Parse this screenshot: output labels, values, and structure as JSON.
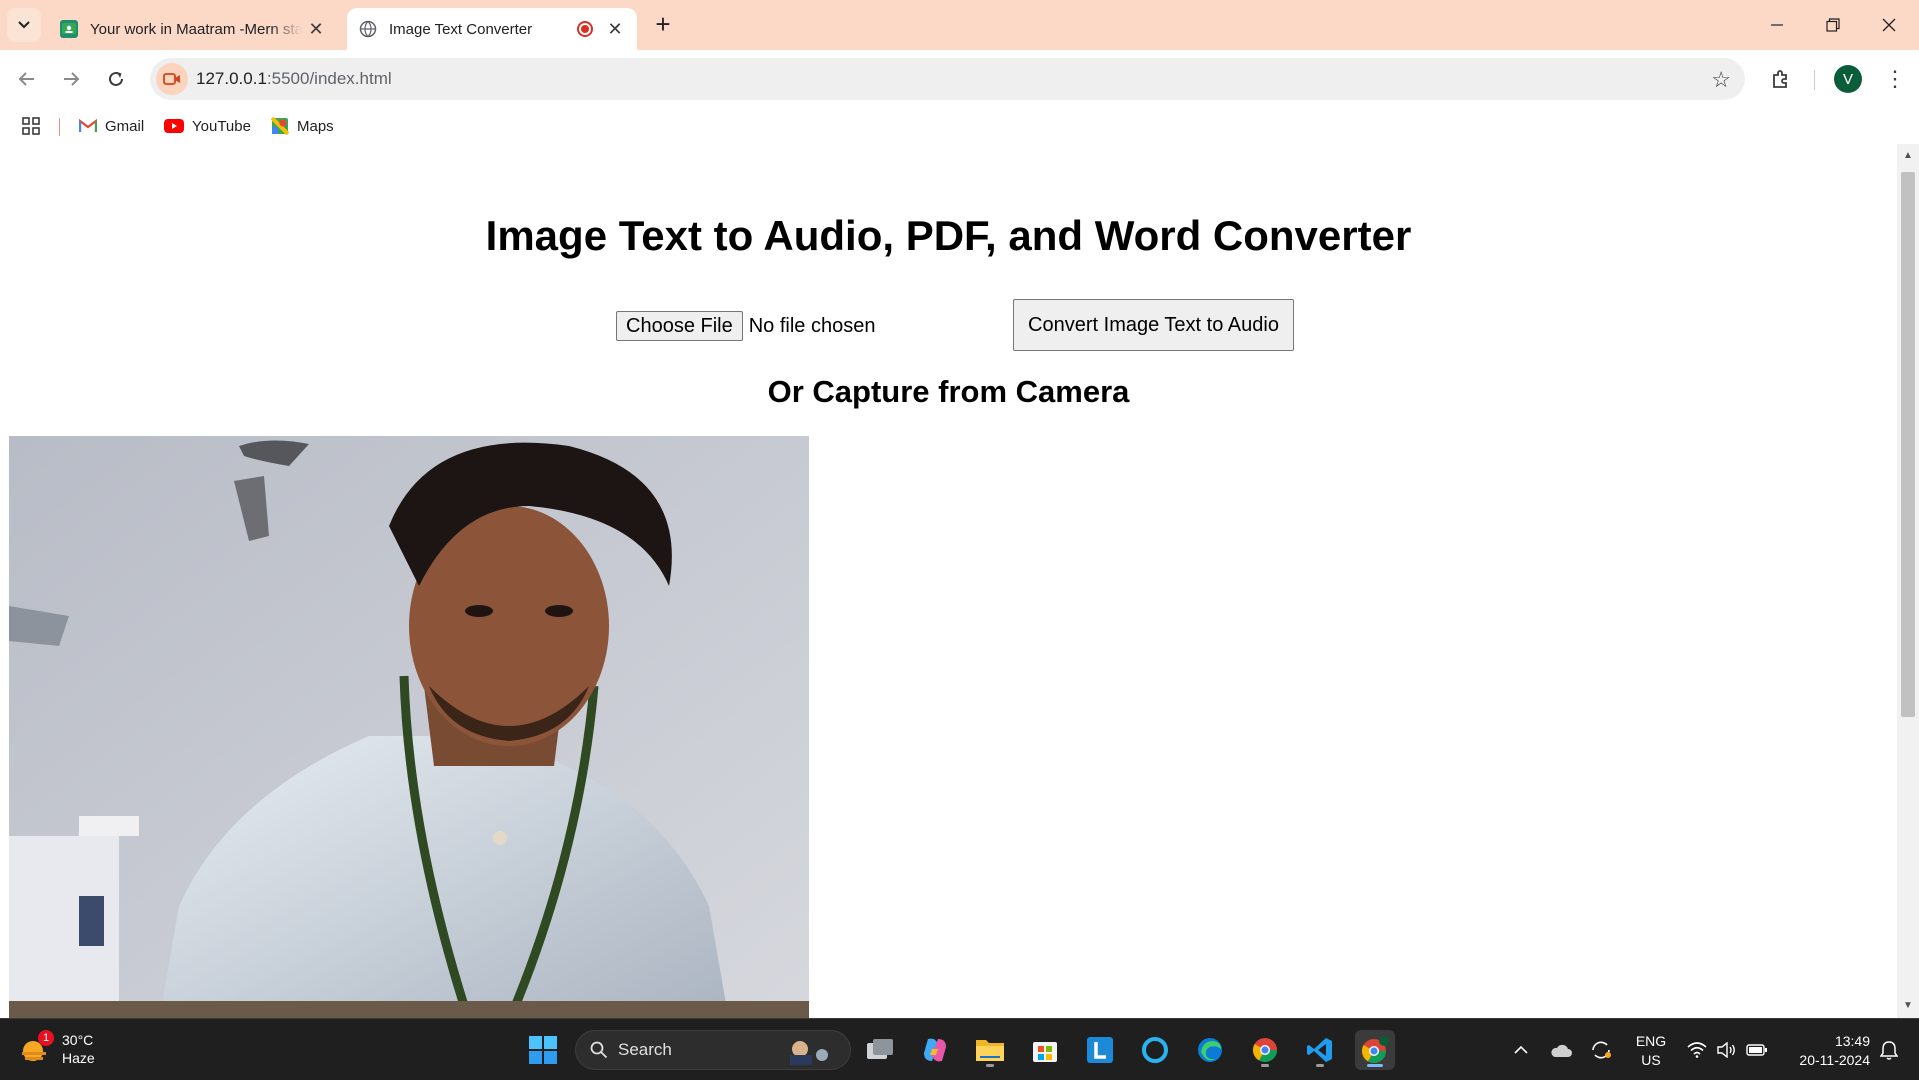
{
  "browser": {
    "tabs": [
      {
        "title": "Your work in Maatram -Mern stack",
        "active": false
      },
      {
        "title": "Image Text Converter",
        "active": true
      }
    ],
    "url_host": "127.0.0.1",
    "url_rest": ":5500/index.html",
    "profile_initial": "V",
    "bookmarks": [
      {
        "label": "Gmail",
        "icon": "gmail-icon"
      },
      {
        "label": "YouTube",
        "icon": "youtube-icon"
      },
      {
        "label": "Maps",
        "icon": "maps-icon"
      }
    ]
  },
  "page": {
    "title": "Image Text to Audio, PDF, and Word Converter",
    "choose_file_label": "Choose File",
    "no_file_text": "No file chosen",
    "convert_button_label": "Convert Image Text to Audio",
    "camera_heading": "Or Capture from Camera"
  },
  "taskbar": {
    "weather_temp": "30°C",
    "weather_desc": "Haze",
    "weather_badge": "1",
    "search_label": "Search",
    "lang_line1": "ENG",
    "lang_line2": "US",
    "time": "13:49",
    "date": "20-11-2024"
  },
  "colors": {
    "tabstrip_bg": "#fcd8c6",
    "taskbar_bg": "#1f1f1f",
    "accent_blue": "#0078d4"
  }
}
